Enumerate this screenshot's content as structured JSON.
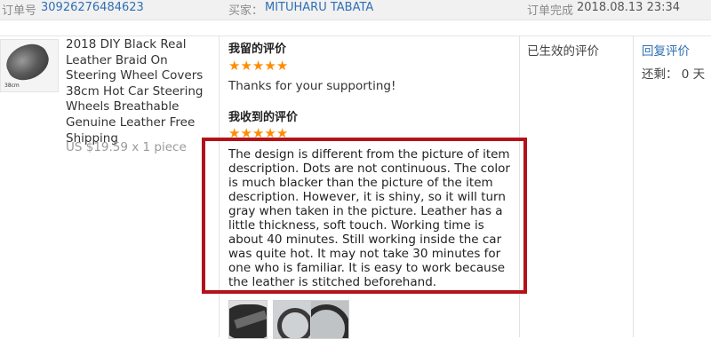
{
  "order": {
    "number_label": "订单号",
    "number_value": "30926276484623",
    "buyer_label": "买家：",
    "buyer_name": "MITUHARU TABATA",
    "completed_label": "订单完成",
    "completed_time": "2018.08.13 23:34"
  },
  "product": {
    "thumbnail_caption": "38cm",
    "title": "2018 DIY Black Real Leather Braid On Steering Wheel Covers 38cm Hot Car Steering Wheels Breathable Genuine Leather Free Shipping",
    "price": "US $19.59 x 1 piece"
  },
  "my_review": {
    "heading": "我留的评价",
    "rating": 5,
    "text": "Thanks for your supporting!"
  },
  "received_review": {
    "heading": "我收到的评价",
    "rating": 5,
    "text": "The design is different from the picture of item description. Dots are not continuous. The color is much blacker than the picture of the item description. However, it is shiny, so it will turn gray when taken in the picture. Leather has a little thickness, soft touch. Working time is about 40 minutes. Still working inside the car was quite hot. It may not take 30 minutes for one who is familiar. It is easy to work because the leather is stitched beforehand.",
    "highlight_color": "#b3121a"
  },
  "photos": [
    "leather-wrap-photo",
    "car-interior-photo",
    "steering-wheel-photo"
  ],
  "status": {
    "text": "已生效的评价"
  },
  "actions": {
    "reply_label": "回复评价",
    "remaining_label": "还剩： 0 天"
  },
  "colors": {
    "link": "#2f6fb4",
    "star": "#ff8c00",
    "header_bg": "#f1f1f1"
  }
}
